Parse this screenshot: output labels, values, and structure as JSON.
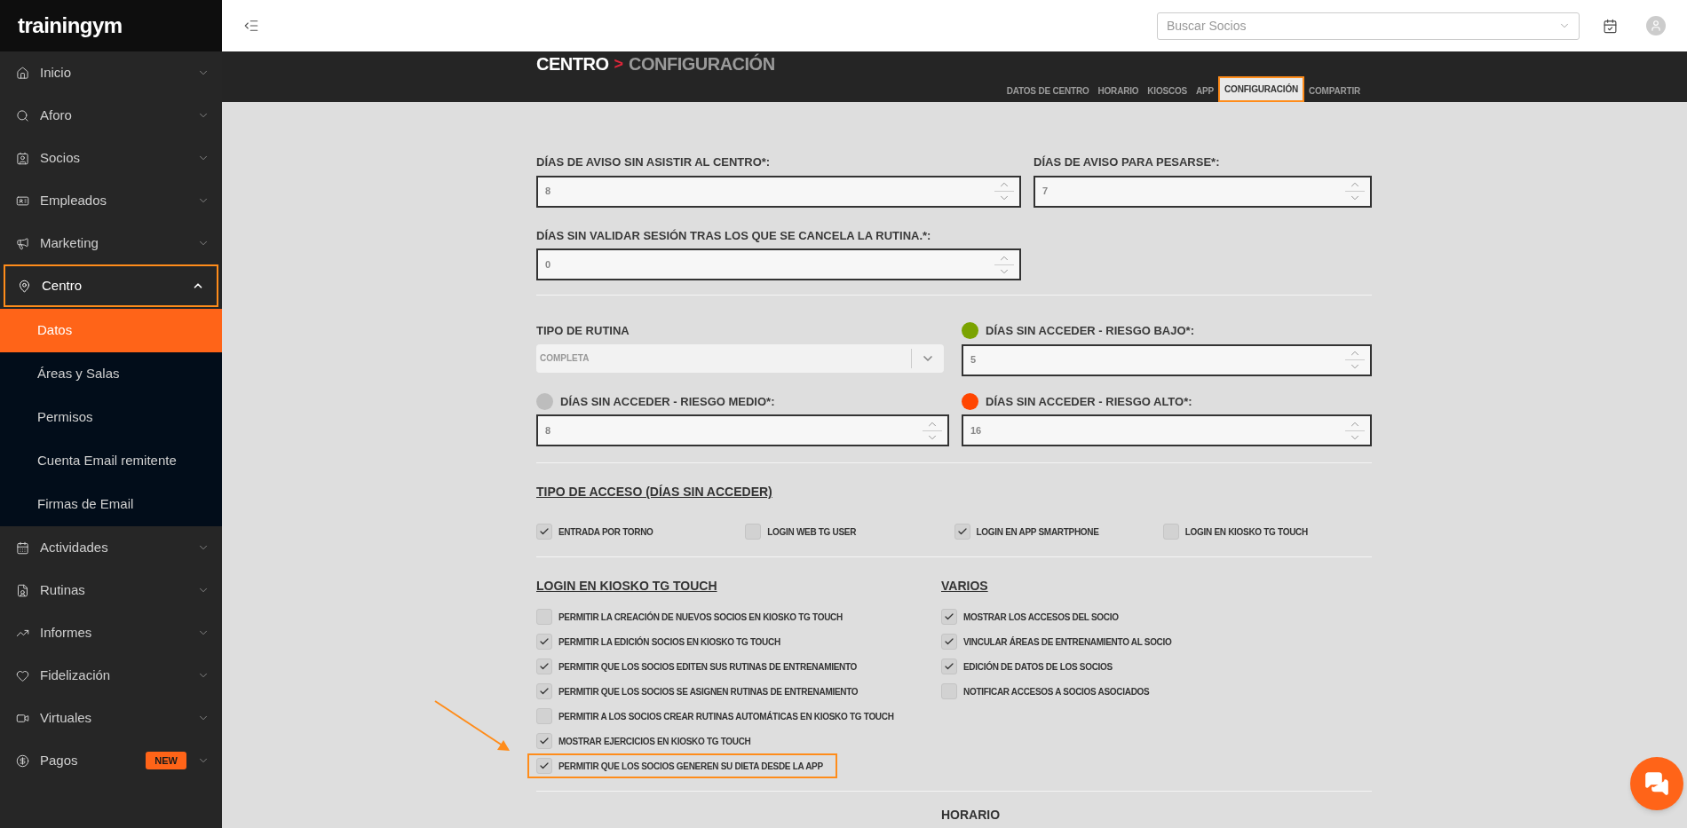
{
  "logo": "trainingym",
  "sidebar": {
    "items": [
      {
        "label": "Inicio",
        "expanded": false,
        "highlighted": false
      },
      {
        "label": "Aforo",
        "expanded": false,
        "highlighted": false
      },
      {
        "label": "Socios",
        "expanded": false,
        "highlighted": false
      },
      {
        "label": "Empleados",
        "expanded": false,
        "highlighted": false
      },
      {
        "label": "Marketing",
        "expanded": false,
        "highlighted": false
      },
      {
        "label": "Centro",
        "expanded": true,
        "highlighted": true,
        "children": [
          {
            "label": "Datos",
            "selected": true
          },
          {
            "label": "Áreas y Salas",
            "selected": false
          },
          {
            "label": "Permisos",
            "selected": false
          },
          {
            "label": "Cuenta Email remitente",
            "selected": false
          },
          {
            "label": "Firmas de Email",
            "selected": false
          }
        ]
      },
      {
        "label": "Actividades",
        "expanded": false,
        "highlighted": false
      },
      {
        "label": "Rutinas",
        "expanded": false,
        "highlighted": false
      },
      {
        "label": "Informes",
        "expanded": false,
        "highlighted": false
      },
      {
        "label": "Fidelización",
        "expanded": false,
        "highlighted": false
      },
      {
        "label": "Virtuales",
        "expanded": false,
        "highlighted": false
      },
      {
        "label": "Pagos",
        "expanded": false,
        "highlighted": false,
        "badge": "NEW"
      }
    ]
  },
  "header": {
    "search": {
      "placeholder": "Buscar Socios"
    }
  },
  "breadcrumb": {
    "parent": "CENTRO",
    "separator": ">",
    "current": "CONFIGURACIÓN"
  },
  "tabs": [
    {
      "label": "DATOS DE CENTRO",
      "selected": false,
      "highlighted": false
    },
    {
      "label": "HORARIO",
      "selected": false,
      "highlighted": false
    },
    {
      "label": "KIOSCOS",
      "selected": false,
      "highlighted": false
    },
    {
      "label": "APP",
      "selected": false,
      "highlighted": false
    },
    {
      "label": "CONFIGURACIÓN",
      "selected": true,
      "highlighted": true
    },
    {
      "label": "COMPARTIR",
      "selected": false,
      "highlighted": false
    }
  ],
  "warnings": {
    "fields": [
      {
        "label": "DÍAS DE AVISO SIN ASISTIR AL CENTRO*:",
        "value": "8"
      },
      {
        "label": "DÍAS DE AVISO PARA PESARSE*:",
        "value": "7"
      },
      {
        "label": "DÍAS SIN VALIDAR SESIÓN TRAS LOS QUE SE CANCELA LA RUTINA.*:",
        "value": "0"
      }
    ]
  },
  "routine": {
    "label": "TIPO DE RUTINA",
    "value": "COMPLETA"
  },
  "risk_fields": [
    {
      "label": "DÍAS SIN ACCEDER - RIESGO BAJO*:",
      "value": "5",
      "color": "#7aa300"
    },
    {
      "label": "DÍAS SIN ACCEDER - RIESGO MEDIO*:",
      "value": "8",
      "color": "#bdbdbd"
    },
    {
      "label": "DÍAS SIN ACCEDER - RIESGO ALTO*:",
      "value": "16",
      "color": "#ff4500"
    }
  ],
  "access": {
    "heading": "TIPO DE ACCESO (DÍAS SIN ACCEDER)",
    "options": [
      {
        "label": "ENTRADA POR TORNO",
        "checked": true
      },
      {
        "label": "LOGIN WEB TG USER",
        "checked": false
      },
      {
        "label": "LOGIN EN APP SMARTPHONE",
        "checked": true
      },
      {
        "label": "LOGIN EN KIOSKO TG TOUCH",
        "checked": false
      }
    ]
  },
  "kiosk": {
    "heading": "LOGIN EN KIOSKO TG TOUCH",
    "options": [
      {
        "label": "PERMITIR LA CREACIÓN DE NUEVOS SOCIOS EN KIOSKO TG TOUCH",
        "checked": false,
        "highlighted": false
      },
      {
        "label": "PERMITIR LA EDICIÓN SOCIOS EN KIOSKO TG TOUCH",
        "checked": true,
        "highlighted": false
      },
      {
        "label": "PERMITIR QUE LOS SOCIOS EDITEN SUS RUTINAS DE ENTRENAMIENTO",
        "checked": true,
        "highlighted": false
      },
      {
        "label": "PERMITIR QUE LOS SOCIOS SE ASIGNEN RUTINAS DE ENTRENAMIENTO",
        "checked": true,
        "highlighted": false
      },
      {
        "label": "PERMITIR A LOS SOCIOS CREAR RUTINAS AUTOMÁTICAS EN KIOSKO TG TOUCH",
        "checked": false,
        "highlighted": false
      },
      {
        "label": "MOSTRAR EJERCICIOS EN KIOSKO TG TOUCH",
        "checked": true,
        "highlighted": false
      },
      {
        "label": "PERMITIR QUE LOS SOCIOS GENEREN SU DIETA DESDE LA APP",
        "checked": true,
        "highlighted": true
      }
    ]
  },
  "varios": {
    "heading": "VARIOS",
    "options": [
      {
        "label": "MOSTRAR LOS ACCESOS DEL SOCIO",
        "checked": true
      },
      {
        "label": "VINCULAR ÁREAS DE ENTRENAMIENTO AL SOCIO",
        "checked": true
      },
      {
        "label": "EDICIÓN DE DATOS DE LOS SOCIOS",
        "checked": true
      },
      {
        "label": "NOTIFICAR ACCESOS A SOCIOS ASOCIADOS",
        "checked": false
      }
    ]
  },
  "schedule": {
    "heading": "HORARIO"
  }
}
